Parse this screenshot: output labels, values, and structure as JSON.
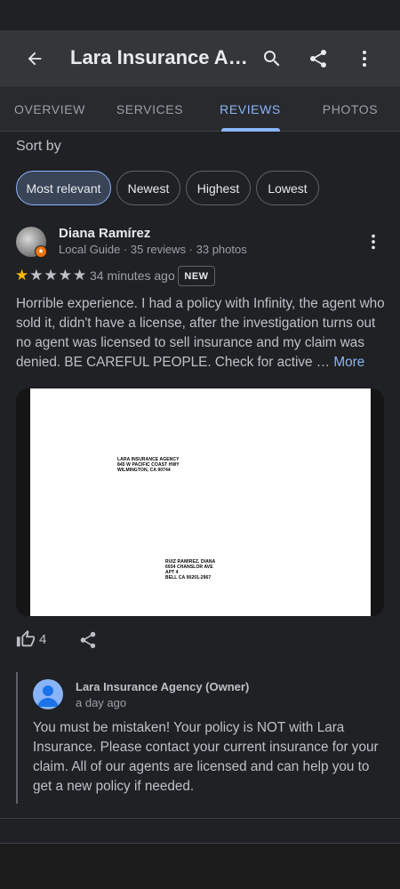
{
  "app_bar": {
    "title": "Lara Insurance Agency",
    "icons": [
      "back-arrow-icon",
      "search-icon",
      "share-icon",
      "more-vert-icon"
    ]
  },
  "tabs": [
    {
      "label": "OVERVIEW",
      "active": false
    },
    {
      "label": "SERVICES",
      "active": false
    },
    {
      "label": "REVIEWS",
      "active": true
    },
    {
      "label": "PHOTOS",
      "active": false
    }
  ],
  "sort": {
    "label": "Sort by",
    "chips": [
      {
        "label": "Most relevant",
        "selected": true
      },
      {
        "label": "Newest",
        "selected": false
      },
      {
        "label": "Highest",
        "selected": false
      },
      {
        "label": "Lowest",
        "selected": false
      }
    ]
  },
  "review": {
    "author": "Diana Ramírez",
    "meta": "Local Guide · 35 reviews · 33 photos",
    "rating": 1,
    "max_rating": 5,
    "time": "34 minutes ago",
    "badge": "NEW",
    "text": "Horrible experience. I had a policy with Infinity, the agent who sold it, didn't have a license, after the investigation turns out no agent was licensed to sell insurance and my claim was denied. BE CAREFUL PEOPLE. Check for active …",
    "more_label": "More",
    "photo": {
      "sender": [
        "LARA INSURANCE AGENCY",
        "845 W PACIFIC COAST HWY",
        "WILMINGTON, CA 90744"
      ],
      "recipient": [
        "RUIZ RAMIREZ, DIANA",
        "6934 CHANSLOR AVE",
        "APT 4",
        "BELL CA  90201-2967"
      ]
    },
    "like_count": "4"
  },
  "owner_response": {
    "name": "Lara Insurance Agency (Owner)",
    "time": "a day ago",
    "text": "You must be mistaken! Your policy is NOT with Lara Insurance. Please contact your current insurance for your claim. All of our agents are licensed and can help you to get a new policy if needed."
  },
  "colors": {
    "accent": "#8ab4f8",
    "star_filled": "#fbbc04",
    "star_empty": "#bdc1c6",
    "background": "#202124",
    "guide_badge": "#e8710a"
  }
}
